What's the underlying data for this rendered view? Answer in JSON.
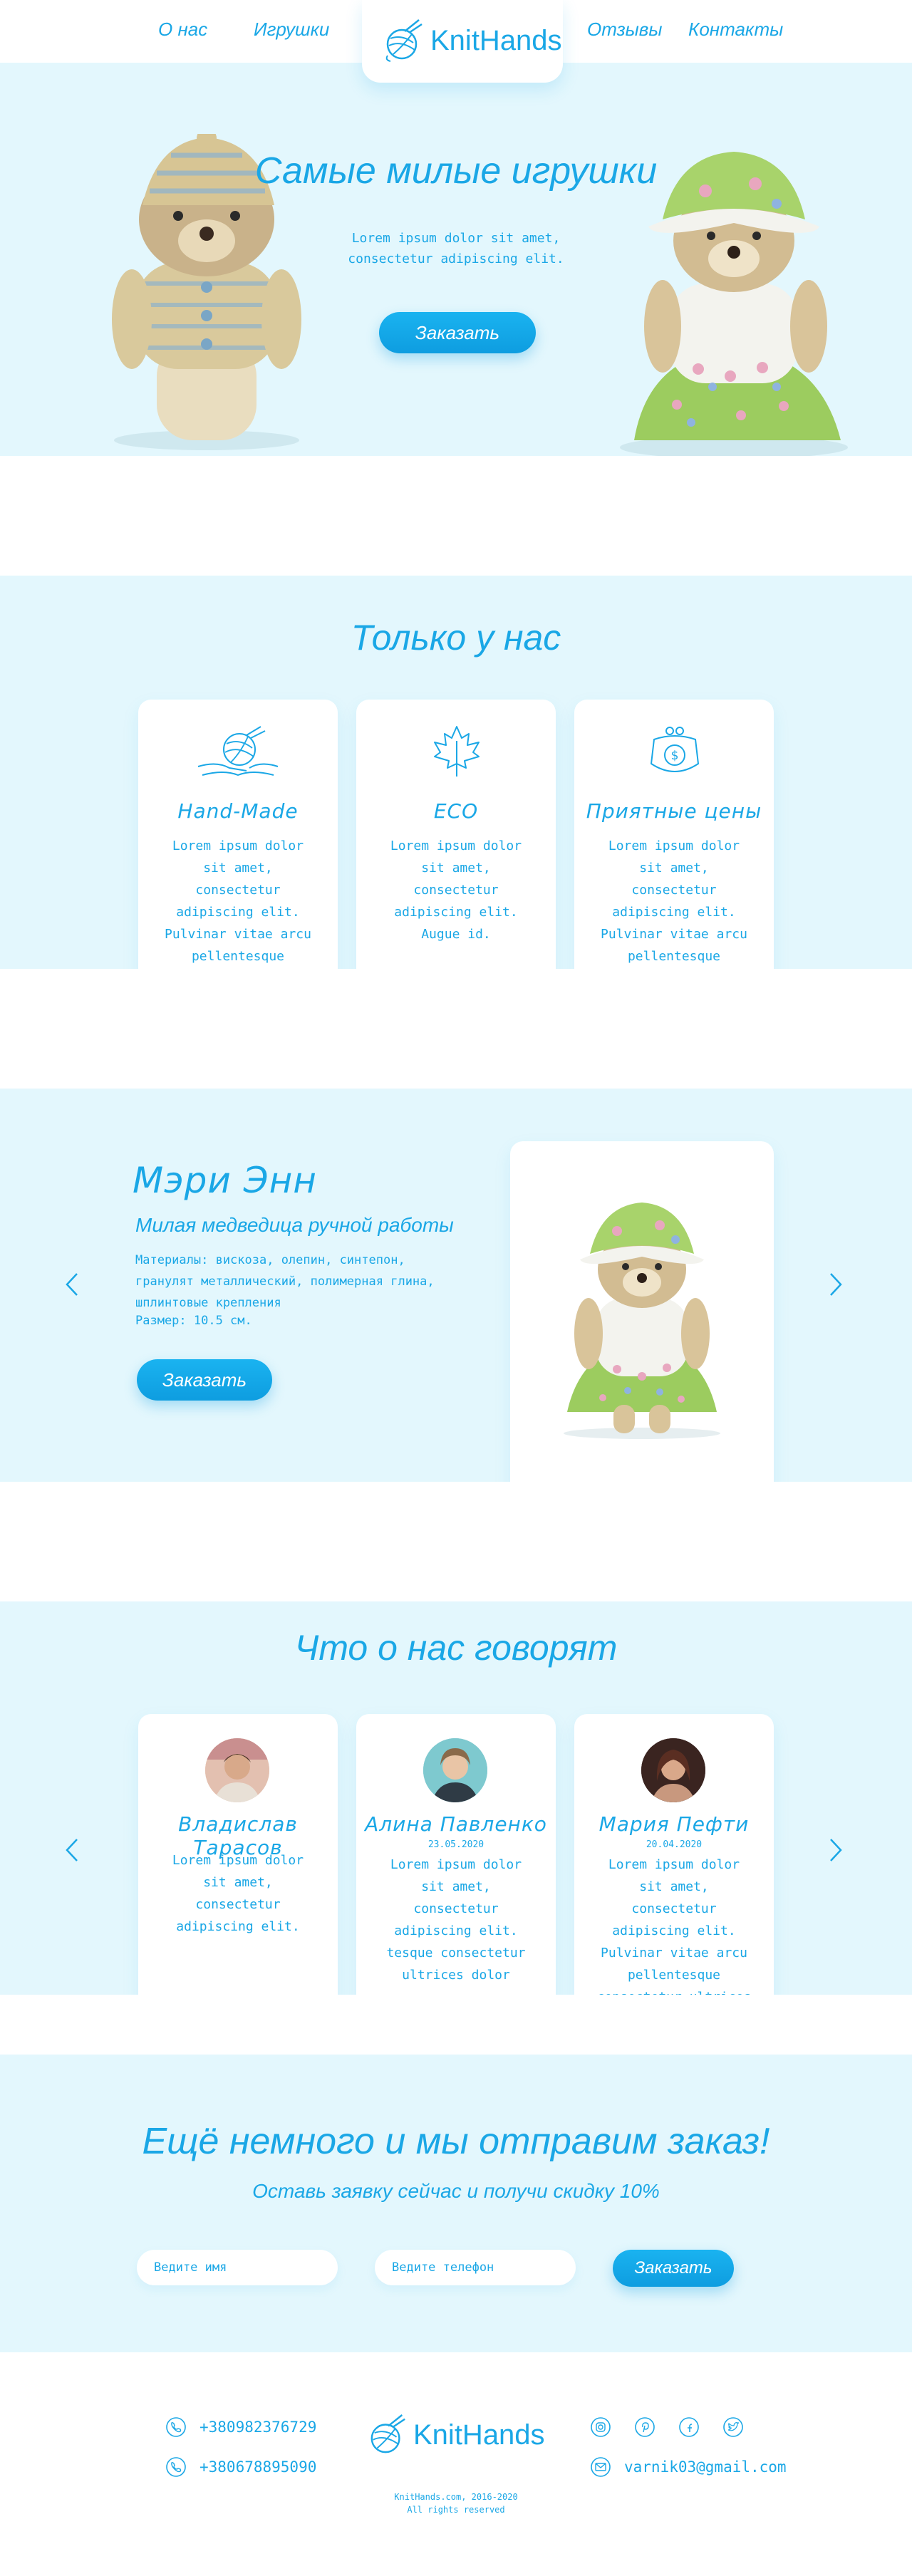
{
  "nav": {
    "items_left": [
      "О нас",
      "Игрушки"
    ],
    "items_right": [
      "Отзывы",
      "Контакты"
    ],
    "logo": "KnitHands"
  },
  "hero": {
    "title": "Самые милые игрушки",
    "text": "Lorem ipsum dolor sit amet, consectetur adipiscing elit.",
    "button": "Заказать"
  },
  "features": {
    "title": "Только у нас",
    "cards": [
      {
        "icon": "yarn-ball-hands-icon",
        "title": "Hand-Made",
        "text": "Lorem ipsum dolor sit amet, consectetur adipiscing elit. Pulvinar vitae arcu pellentesque consectetur ultrices."
      },
      {
        "icon": "maple-leaf-icon",
        "title": "ECO",
        "text": "Lorem ipsum dolor sit amet, consectetur adipiscing elit. Augue id."
      },
      {
        "icon": "coin-purse-icon",
        "title": "Приятные цены",
        "text": "Lorem ipsum dolor sit amet, consectetur adipiscing elit. Pulvinar vitae arcu pellentesque consectetur ultrices dolor et."
      }
    ]
  },
  "product": {
    "name": "Мэри Энн",
    "subtitle": "Милая медведица ручной работы",
    "materials": "Материалы: вискоза, олепин, синтепон, гранулят металлический, полимерная глина, шплинтовые крепления",
    "size": "Размер: 10.5 см.",
    "button": "Заказать"
  },
  "reviews": {
    "title": "Что о нас говорят",
    "cards": [
      {
        "name": "Владислав Тарасов",
        "date": "",
        "text": "Lorem ipsum dolor sit amet, consectetur adipiscing elit."
      },
      {
        "name": "Алина Павленко",
        "date": "23.05.2020",
        "text": "Lorem ipsum dolor sit amet, consectetur adipiscing elit. tesque consectetur ultrices dolor"
      },
      {
        "name": "Мария Пефти",
        "date": "20.04.2020",
        "text": "Lorem ipsum dolor sit amet, consectetur adipiscing elit. Pulvinar vitae arcu pellentesque consectetur ultrices dolor"
      }
    ]
  },
  "order": {
    "title": "Ещё немного и мы отправим заказ!",
    "subtitle": "Оставь заявку сейчас и получи скидку 10%",
    "name_placeholder": "Ведите имя",
    "phone_placeholder": "Ведите телефон",
    "button": "Заказать"
  },
  "footer": {
    "phone1": "+380982376729",
    "phone2": "+380678895090",
    "logo": "KnitHands",
    "email": "varnik03@gmail.com",
    "copyright1": "KnitHands.com, 2016-2020",
    "copyright2": "All rights reserved"
  },
  "colors": {
    "accent": "#1aa7e6",
    "section_bg": "#e3f7fd",
    "button": "#0e9de0"
  }
}
